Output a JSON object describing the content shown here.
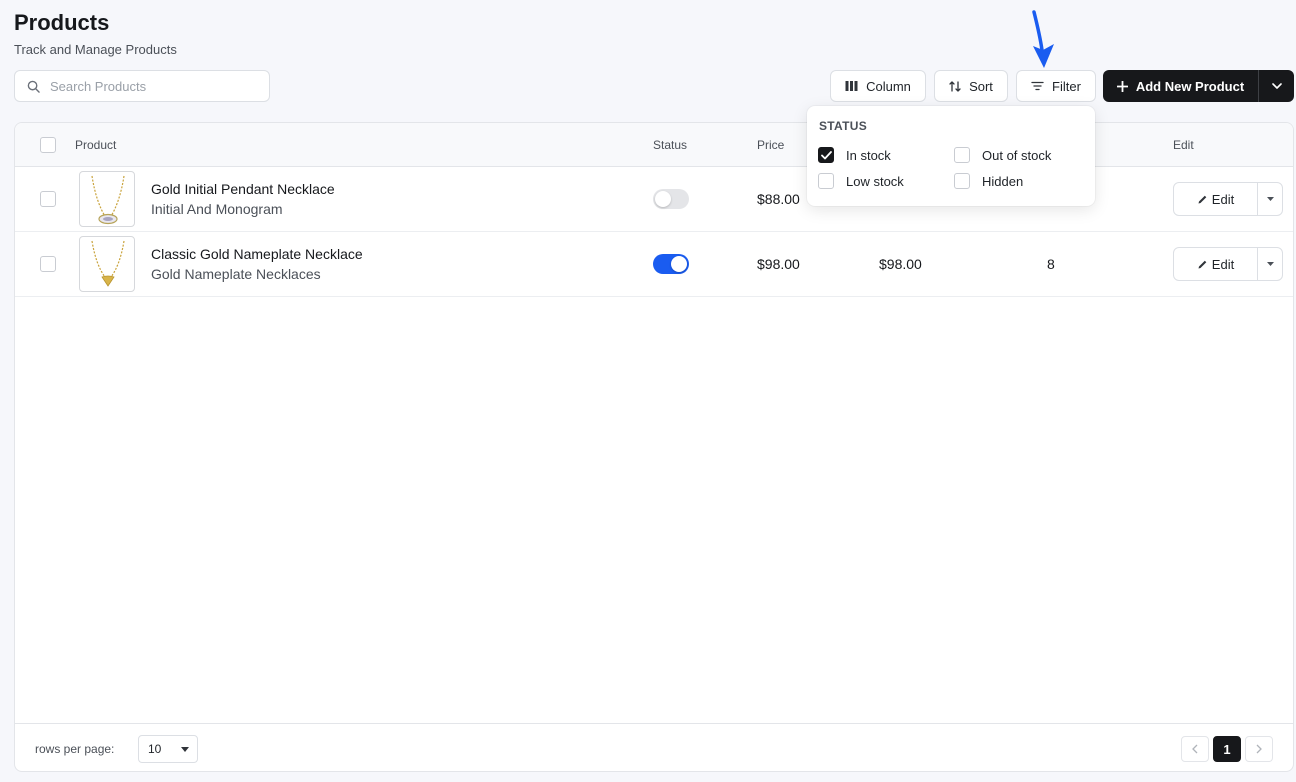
{
  "header": {
    "title": "Products",
    "subtitle": "Track and Manage Products"
  },
  "search": {
    "placeholder": "Search Products",
    "value": ""
  },
  "toolbar": {
    "column_label": "Column",
    "sort_label": "Sort",
    "filter_label": "Filter",
    "add_label": "Add New Product"
  },
  "table": {
    "columns": [
      "Product",
      "Status",
      "Price",
      "Edit"
    ],
    "rows": [
      {
        "name": "Gold Initial Pendant Necklace",
        "category": "Initial And Monogram",
        "status_on": false,
        "price": "$88.00",
        "sale_price": "",
        "stock": "",
        "edit_label": "Edit"
      },
      {
        "name": "Classic Gold Nameplate Necklace",
        "category": "Gold Nameplate Necklaces",
        "status_on": true,
        "price": "$98.00",
        "sale_price": "$98.00",
        "stock": "8",
        "edit_label": "Edit"
      }
    ]
  },
  "filter_popover": {
    "heading": "STATUS",
    "options": [
      {
        "label": "In stock",
        "checked": true
      },
      {
        "label": "Out of stock",
        "checked": false
      },
      {
        "label": "Low stock",
        "checked": false
      },
      {
        "label": "Hidden",
        "checked": false
      }
    ]
  },
  "footer": {
    "rows_per_page_label": "rows per page:",
    "rows_per_page_value": "10",
    "current_page": "1"
  },
  "colors": {
    "accent": "#1a5cf0",
    "primary_dark": "#17181b",
    "annotation_arrow": "#1a5cf0"
  },
  "icons": [
    "search-icon",
    "columns-icon",
    "sort-icon",
    "filter-icon",
    "plus-icon",
    "chevron-down-icon",
    "pencil-icon",
    "caret-down-icon",
    "chevron-left-icon",
    "chevron-right-icon",
    "check-icon"
  ]
}
